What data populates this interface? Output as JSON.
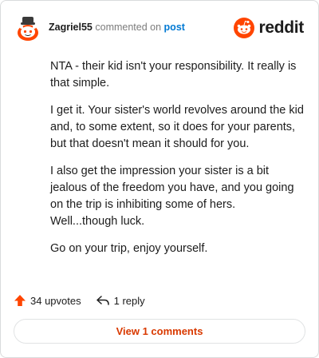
{
  "header": {
    "username": "Zagriel55",
    "verb": "commented on",
    "post_link": "post",
    "brand": "reddit"
  },
  "comment": {
    "paragraphs": [
      "NTA - their kid isn't your responsibility. It really is that simple.",
      "I get it. Your sister's world revolves around the kid and, to some extent, so it does for your parents, but that doesn't mean it should for you.",
      "I also get the impression your sister is a bit jealous of the freedom you have, and you going on the trip is inhibiting some of hers. Well...though luck.",
      "Go on your trip, enjoy yourself."
    ]
  },
  "actions": {
    "upvotes": "34 upvotes",
    "replies": "1 reply"
  },
  "footer": {
    "view_comments": "View 1 comments"
  },
  "icons": {
    "avatar": "snoo-avatar-icon",
    "brand": "reddit-logo-icon",
    "upvote": "upvote-arrow-icon",
    "reply": "reply-arrow-icon"
  },
  "colors": {
    "brand_orange": "#ff4500",
    "link_blue": "#0079d3",
    "view_button_text": "#d93900",
    "upvote_arrow": "#ff4500"
  }
}
